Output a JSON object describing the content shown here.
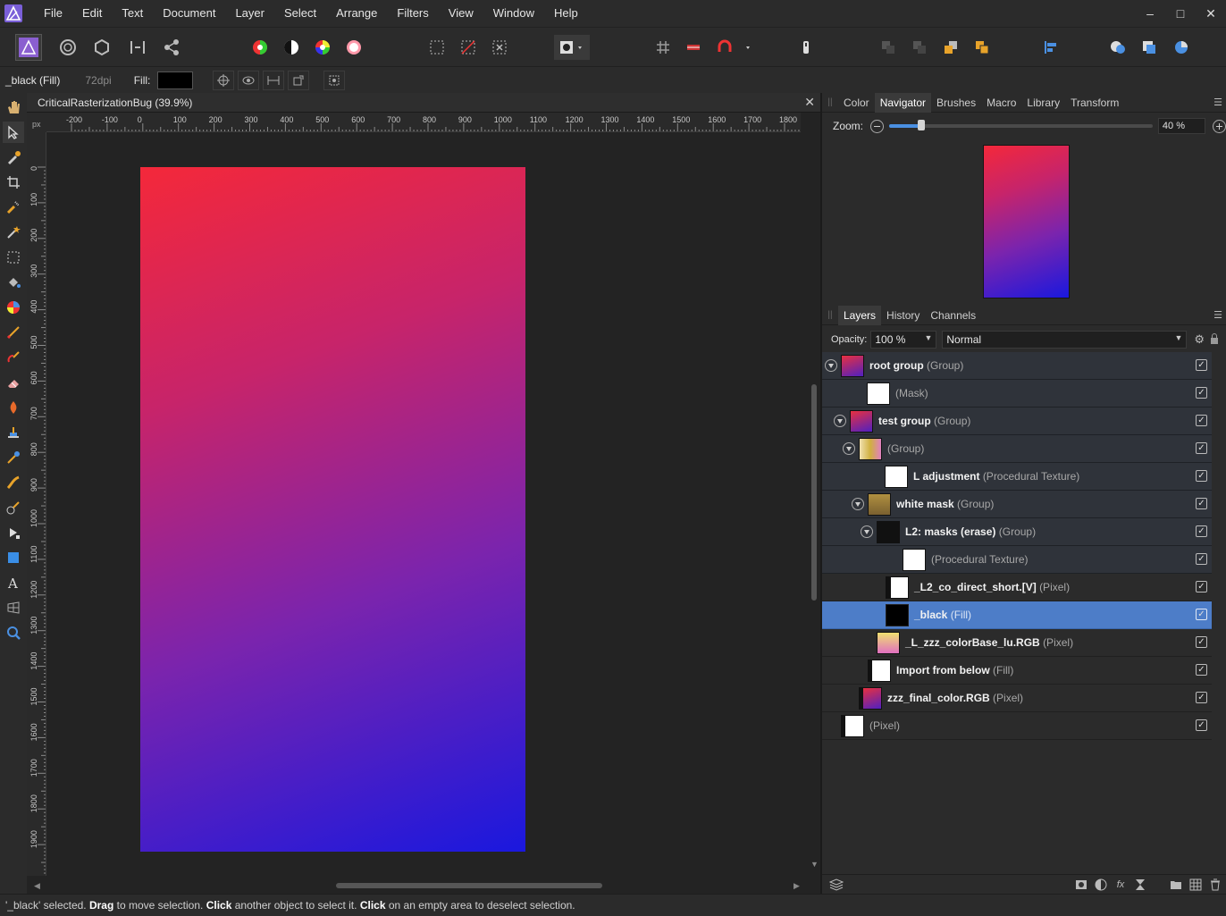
{
  "menubar": {
    "items": [
      "File",
      "Edit",
      "Text",
      "Document",
      "Layer",
      "Select",
      "Arrange",
      "Filters",
      "View",
      "Window",
      "Help"
    ],
    "window_controls": {
      "minimize": "–",
      "maximize": "□",
      "close": "✕"
    }
  },
  "context_bar": {
    "title": "_black (Fill)",
    "dpi": "72dpi",
    "fill_label": "Fill:",
    "fill_color": "#000000"
  },
  "document": {
    "tab_title": "CriticalRasterizationBug (39.9%)",
    "close": "✕",
    "ruler_unit": "px",
    "h_ticks": [
      "-200",
      "-100",
      "0",
      "100",
      "200",
      "300",
      "400",
      "500",
      "600",
      "700",
      "800",
      "900",
      "1000",
      "1100",
      "1200",
      "1300",
      "1400",
      "1500",
      "1600",
      "1700",
      "1800"
    ],
    "v_ticks": [
      "0",
      "100",
      "200",
      "300",
      "400",
      "500",
      "600",
      "700",
      "800",
      "900",
      "1000",
      "1100",
      "1200",
      "1300",
      "1400",
      "1500",
      "1600",
      "1700",
      "1800",
      "1900"
    ]
  },
  "top_panel": {
    "tabs": [
      "Color",
      "Navigator",
      "Brushes",
      "Macro",
      "Library",
      "Transform"
    ],
    "active": "Navigator",
    "zoom_label": "Zoom:",
    "zoom_value": "40 %",
    "zoom_level": 0.12
  },
  "layers_panel": {
    "tabs": [
      "Layers",
      "History",
      "Channels"
    ],
    "active": "Layers",
    "opacity_label": "Opacity:",
    "opacity_value": "100 %",
    "blend_mode": "Normal",
    "layers": [
      {
        "name": "root group",
        "type": "(Group)",
        "bold": true
      },
      {
        "name": "",
        "type": "(Mask)",
        "bold": false
      },
      {
        "name": "test group",
        "type": "(Group)",
        "bold": true
      },
      {
        "name": "",
        "type": "(Group)",
        "bold": false
      },
      {
        "name": "L adjustment",
        "type": "(Procedural Texture)",
        "bold": true
      },
      {
        "name": "white mask",
        "type": "(Group)",
        "bold": true
      },
      {
        "name": "L2: masks (erase)",
        "type": "(Group)",
        "bold": true
      },
      {
        "name": "",
        "type": "(Procedural Texture)",
        "bold": false
      },
      {
        "name": "_L2_co_direct_short.[V]",
        "type": "(Pixel)",
        "bold": true
      },
      {
        "name": "_black",
        "type": "(Fill)",
        "bold": true
      },
      {
        "name": "_L_zzz_colorBase_lu.RGB",
        "type": "(Pixel)",
        "bold": true
      },
      {
        "name": "Import from below",
        "type": "(Fill)",
        "bold": true
      },
      {
        "name": "zzz_final_color.RGB",
        "type": "(Pixel)",
        "bold": true
      },
      {
        "name": "",
        "type": "(Pixel)",
        "bold": false
      }
    ]
  },
  "status": {
    "p1": "'_black' selected. ",
    "b1": "Drag",
    "p2": " to move selection. ",
    "b2": "Click",
    "p3": " another object to select it. ",
    "b3": "Click",
    "p4": " on an empty area to deselect selection."
  }
}
